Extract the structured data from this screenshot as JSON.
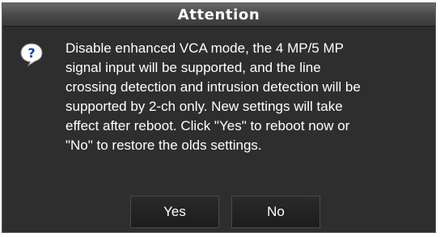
{
  "dialog": {
    "title": "Attention",
    "icon": "question-icon",
    "message": "Disable enhanced VCA mode, the 4 MP/5 MP\nsignal input will be supported, and the line\ncrossing detection and intrusion detection will be\nsupported by 2-ch only. New settings will take\neffect after reboot. Click \"Yes\" to reboot now or\n\"No\" to restore the olds settings.",
    "yes_label": "Yes",
    "no_label": "No"
  },
  "colors": {
    "background": "#2e2e2e",
    "title_bar": "#4c4c4c",
    "text": "#ffffff",
    "icon_fill": "#ffffff",
    "icon_glyph": "#1a3fa8"
  }
}
